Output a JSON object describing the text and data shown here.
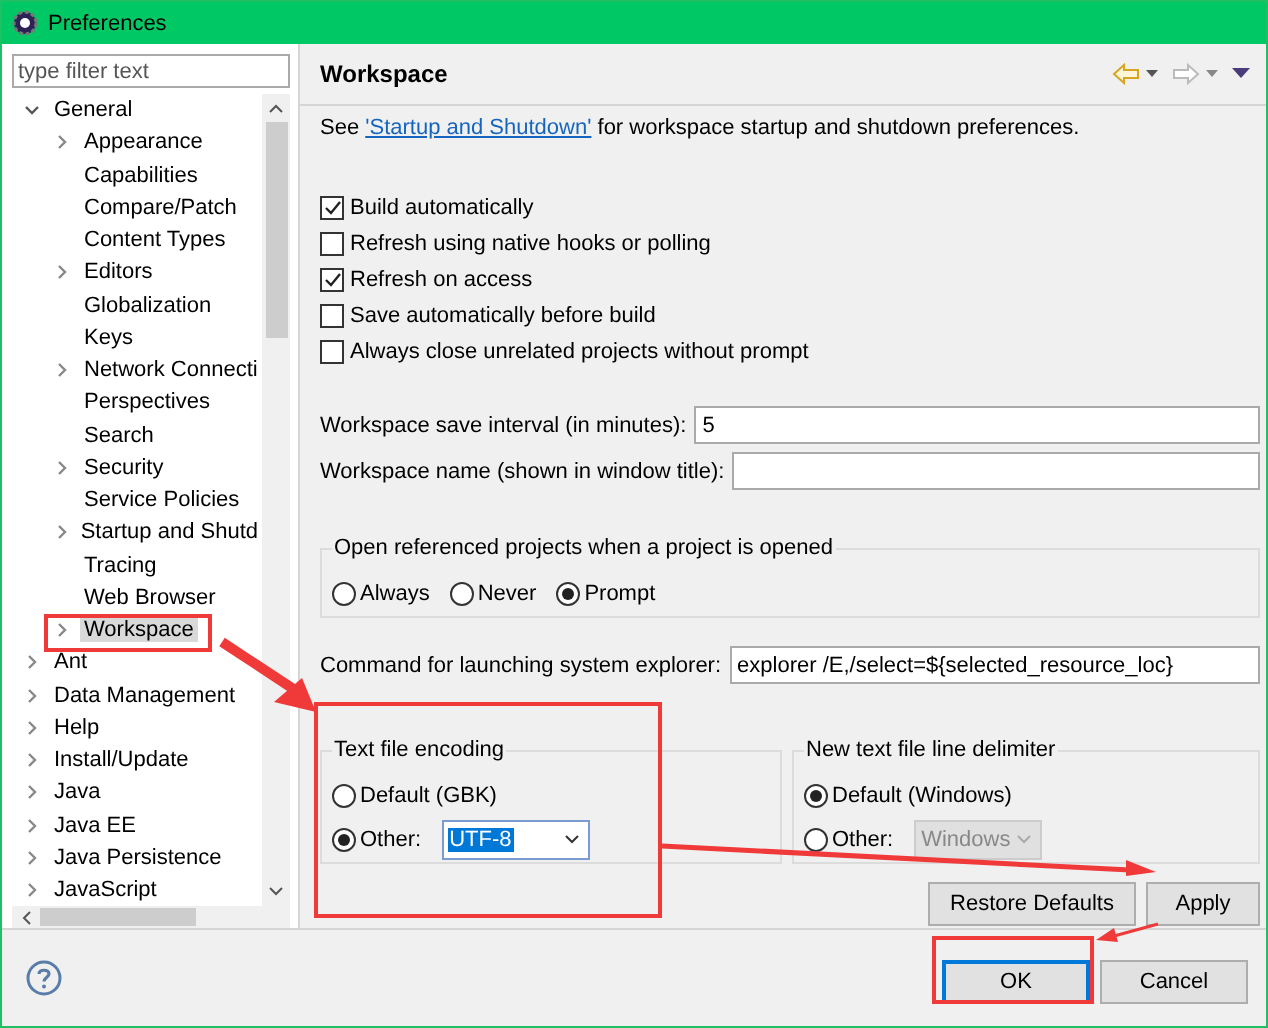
{
  "window": {
    "title": "Preferences"
  },
  "filter": {
    "placeholder": "type filter text"
  },
  "tree": [
    {
      "label": "General",
      "expanded": true,
      "selected": false,
      "children": [
        {
          "label": "Appearance",
          "expanded": false,
          "selected": false
        },
        {
          "label": "Capabilities",
          "selected": false
        },
        {
          "label": "Compare/Patch",
          "selected": false
        },
        {
          "label": "Content Types",
          "selected": false
        },
        {
          "label": "Editors",
          "expanded": false,
          "selected": false
        },
        {
          "label": "Globalization",
          "selected": false
        },
        {
          "label": "Keys",
          "selected": false
        },
        {
          "label": "Network Connecti",
          "expanded": false,
          "selected": false
        },
        {
          "label": "Perspectives",
          "selected": false
        },
        {
          "label": "Search",
          "selected": false
        },
        {
          "label": "Security",
          "expanded": false,
          "selected": false
        },
        {
          "label": "Service Policies",
          "selected": false
        },
        {
          "label": "Startup and Shutd",
          "expanded": false,
          "selected": false
        },
        {
          "label": "Tracing",
          "selected": false
        },
        {
          "label": "Web Browser",
          "selected": false
        },
        {
          "label": "Workspace",
          "expanded": false,
          "selected": true
        }
      ]
    },
    {
      "label": "Ant",
      "expanded": false,
      "selected": false
    },
    {
      "label": "Data Management",
      "expanded": false,
      "selected": false
    },
    {
      "label": "Help",
      "expanded": false,
      "selected": false
    },
    {
      "label": "Install/Update",
      "expanded": false,
      "selected": false
    },
    {
      "label": "Java",
      "expanded": false,
      "selected": false
    },
    {
      "label": "Java EE",
      "expanded": false,
      "selected": false
    },
    {
      "label": "Java Persistence",
      "expanded": false,
      "selected": false
    },
    {
      "label": "JavaScript",
      "expanded": false,
      "selected": false
    }
  ],
  "page": {
    "title": "Workspace",
    "intro_before": "See ",
    "link": "'Startup and Shutdown'",
    "intro_after": " for workspace startup and shutdown preferences.",
    "options": [
      {
        "label": "Build automatically",
        "checked": true
      },
      {
        "label": "Refresh using native hooks or polling",
        "checked": false
      },
      {
        "label": "Refresh on access",
        "checked": true
      },
      {
        "label": "Save automatically before build",
        "checked": false
      },
      {
        "label": "Always close unrelated projects without prompt",
        "checked": false
      }
    ],
    "fields": [
      {
        "label": "Workspace save interval (in minutes):",
        "value": "5"
      },
      {
        "label": "Workspace name (shown in window title):"
      }
    ],
    "open_group": {
      "title": "Open referenced projects when a project is opened",
      "choices": [
        {
          "label": "Always",
          "selected": false
        },
        {
          "label": "Never",
          "selected": false
        },
        {
          "label": "Prompt",
          "selected": true
        }
      ]
    },
    "explorer_command": {
      "label": "Command for launching system explorer:",
      "value": "explorer /E,/select=${selected_resource_loc}"
    },
    "encoding": {
      "title": "Text file encoding",
      "choices": [
        {
          "label": "Default (GBK)",
          "selected": false
        },
        {
          "label": "Other:",
          "selected": true,
          "value": "UTF-8",
          "disabled": false
        }
      ]
    },
    "delimiter": {
      "title": "New text file line delimiter",
      "choices": [
        {
          "label": "Default (Windows)",
          "selected": true
        },
        {
          "label": "Other:",
          "selected": false,
          "value": "Windows",
          "disabled": true
        }
      ]
    },
    "page_buttons": [
      "Restore Defaults",
      "Apply"
    ]
  },
  "dialog_buttons": [
    {
      "label": "OK",
      "default": true
    },
    {
      "label": "Cancel",
      "default": false
    }
  ]
}
